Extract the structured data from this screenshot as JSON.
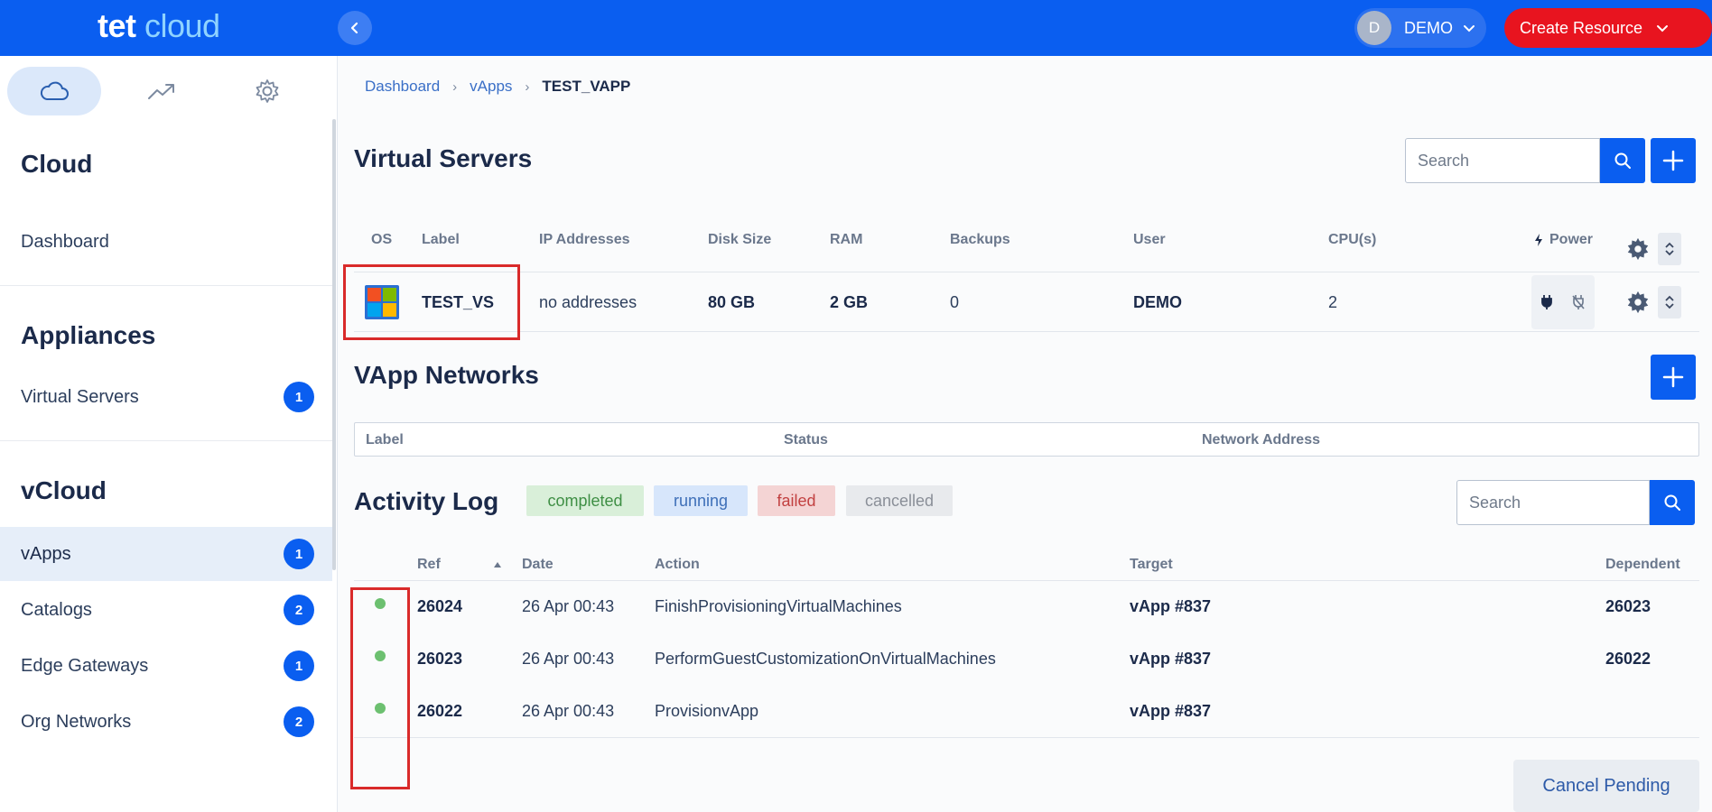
{
  "header": {
    "logo_bold": "tet",
    "logo_light": "cloud",
    "collapse_icon": "chevron-left-icon",
    "user_initial": "D",
    "user_name": "DEMO",
    "create_label": "Create Resource"
  },
  "sidebar": {
    "tabs": [
      {
        "icon": "cloud-icon",
        "active": true
      },
      {
        "icon": "trending-up-icon",
        "active": false
      },
      {
        "icon": "gear-icon",
        "active": false
      }
    ],
    "sections": {
      "cloud": {
        "title": "Cloud",
        "items": [
          {
            "label": "Dashboard"
          }
        ]
      },
      "appliances": {
        "title": "Appliances",
        "items": [
          {
            "label": "Virtual Servers",
            "count": "1"
          }
        ]
      },
      "vcloud": {
        "title": "vCloud",
        "items": [
          {
            "label": "vApps",
            "count": "1",
            "active": true
          },
          {
            "label": "Catalogs",
            "count": "2"
          },
          {
            "label": "Edge Gateways",
            "count": "1"
          },
          {
            "label": "Org Networks",
            "count": "2"
          }
        ]
      }
    }
  },
  "breadcrumb": {
    "items": [
      "Dashboard",
      "vApps"
    ],
    "current": "TEST_VAPP"
  },
  "virtual_servers": {
    "title": "Virtual Servers",
    "search_placeholder": "Search",
    "columns": [
      "OS",
      "Label",
      "IP Addresses",
      "Disk Size",
      "RAM",
      "Backups",
      "User",
      "CPU(s)",
      "Power"
    ],
    "rows": [
      {
        "os": "windows-icon",
        "label": "TEST_VS",
        "ip": "no addresses",
        "disk": "80 GB",
        "ram": "2 GB",
        "backups": "0",
        "user": "DEMO",
        "cpus": "2"
      }
    ]
  },
  "vapp_networks": {
    "title": "VApp Networks",
    "columns": [
      "Label",
      "Status",
      "Network Address"
    ]
  },
  "activity_log": {
    "title": "Activity Log",
    "filters": [
      "completed",
      "running",
      "failed",
      "cancelled"
    ],
    "search_placeholder": "Search",
    "columns": [
      "Ref",
      "Date",
      "Action",
      "Target",
      "Dependent"
    ],
    "rows": [
      {
        "status": "completed",
        "ref": "26024",
        "date": "26 Apr 00:43",
        "action": "FinishProvisioningVirtualMachines",
        "target": "vApp #837",
        "dependent": "26023"
      },
      {
        "status": "completed",
        "ref": "26023",
        "date": "26 Apr 00:43",
        "action": "PerformGuestCustomizationOnVirtualMachines",
        "target": "vApp #837",
        "dependent": "26022"
      },
      {
        "status": "completed",
        "ref": "26022",
        "date": "26 Apr 00:43",
        "action": "ProvisionvApp",
        "target": "vApp #837",
        "dependent": ""
      }
    ],
    "cancel_label": "Cancel Pending"
  },
  "colors": {
    "brand_blue": "#0a5ef0",
    "create_red": "#e8141f",
    "status_completed": "#6cc070",
    "highlight": "#d92a2a"
  }
}
